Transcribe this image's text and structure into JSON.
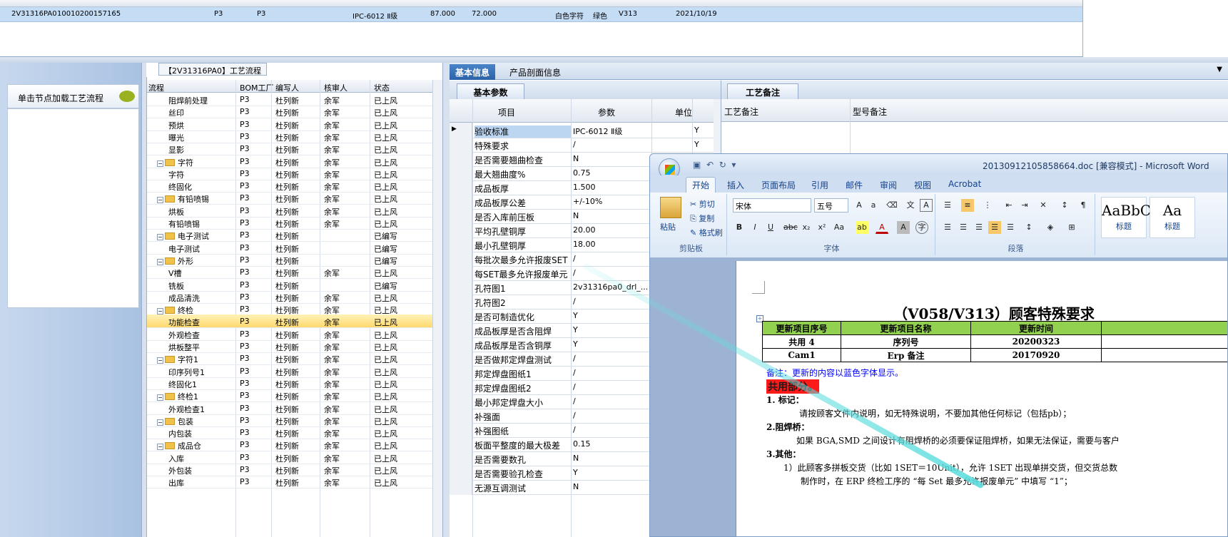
{
  "top_row": {
    "cells": [
      "2V31316PA0",
      "10010200157165",
      "P3",
      "P3",
      "IPC-6012 Ⅱ级",
      "87.000",
      "72.000",
      "白色字符",
      "绿色",
      "V313",
      "2021/10/19"
    ]
  },
  "left_panel": {
    "title": "单击节点加载工艺流程"
  },
  "process": {
    "title": "【2V31316PA0】工艺流程",
    "headers": [
      "流程",
      "BOM工厂",
      "编写人",
      "核审人",
      "状态"
    ],
    "rows": [
      {
        "name": "阻焊前处理",
        "level": 2,
        "bom": "P3",
        "writer": "杜列新",
        "reviewer": "余军",
        "status": "已上风"
      },
      {
        "name": "丝印",
        "level": 2,
        "bom": "P3",
        "writer": "杜列新",
        "reviewer": "余军",
        "status": "已上风"
      },
      {
        "name": "预烘",
        "level": 2,
        "bom": "P3",
        "writer": "杜列新",
        "reviewer": "余军",
        "status": "已上风"
      },
      {
        "name": "曝光",
        "level": 2,
        "bom": "P3",
        "writer": "杜列新",
        "reviewer": "余军",
        "status": "已上风"
      },
      {
        "name": "显影",
        "level": 2,
        "bom": "P3",
        "writer": "杜列新",
        "reviewer": "余军",
        "status": "已上风"
      },
      {
        "name": "字符",
        "level": 1,
        "bom": "P3",
        "writer": "杜列新",
        "reviewer": "余军",
        "status": "已上风"
      },
      {
        "name": "字符",
        "level": 2,
        "bom": "P3",
        "writer": "杜列新",
        "reviewer": "余军",
        "status": "已上风"
      },
      {
        "name": "终固化",
        "level": 2,
        "bom": "P3",
        "writer": "杜列新",
        "reviewer": "余军",
        "status": "已上风"
      },
      {
        "name": "有铅喷锡",
        "level": 1,
        "bom": "P3",
        "writer": "杜列新",
        "reviewer": "余军",
        "status": "已上风"
      },
      {
        "name": "烘板",
        "level": 2,
        "bom": "P3",
        "writer": "杜列新",
        "reviewer": "余军",
        "status": "已上风"
      },
      {
        "name": "有铅喷锡",
        "level": 2,
        "bom": "P3",
        "writer": "杜列新",
        "reviewer": "余军",
        "status": "已上风"
      },
      {
        "name": "电子测试",
        "level": 1,
        "bom": "P3",
        "writer": "杜列新",
        "reviewer": "",
        "status": "已编写"
      },
      {
        "name": "电子测试",
        "level": 2,
        "bom": "P3",
        "writer": "杜列新",
        "reviewer": "",
        "status": "已编写"
      },
      {
        "name": "外形",
        "level": 1,
        "bom": "P3",
        "writer": "杜列新",
        "reviewer": "",
        "status": "已编写"
      },
      {
        "name": "V槽",
        "level": 2,
        "bom": "P3",
        "writer": "杜列新",
        "reviewer": "余军",
        "status": "已上风"
      },
      {
        "name": "铣板",
        "level": 2,
        "bom": "P3",
        "writer": "杜列新",
        "reviewer": "",
        "status": "已编写"
      },
      {
        "name": "成品清洗",
        "level": 2,
        "bom": "P3",
        "writer": "杜列新",
        "reviewer": "余军",
        "status": "已上风"
      },
      {
        "name": "终检",
        "level": 1,
        "bom": "P3",
        "writer": "杜列新",
        "reviewer": "余军",
        "status": "已上风"
      },
      {
        "name": "功能检查",
        "level": 2,
        "bom": "P3",
        "writer": "杜列新",
        "reviewer": "余军",
        "status": "已上风",
        "selected": true
      },
      {
        "name": "外观检查",
        "level": 2,
        "bom": "P3",
        "writer": "杜列新",
        "reviewer": "余军",
        "status": "已上风"
      },
      {
        "name": "烘板整平",
        "level": 2,
        "bom": "P3",
        "writer": "杜列新",
        "reviewer": "余军",
        "status": "已上风"
      },
      {
        "name": "字符1",
        "level": 1,
        "bom": "P3",
        "writer": "杜列新",
        "reviewer": "余军",
        "status": "已上风"
      },
      {
        "name": "印序列号1",
        "level": 2,
        "bom": "P3",
        "writer": "杜列新",
        "reviewer": "余军",
        "status": "已上风"
      },
      {
        "name": "终固化1",
        "level": 2,
        "bom": "P3",
        "writer": "杜列新",
        "reviewer": "余军",
        "status": "已上风"
      },
      {
        "name": "终检1",
        "level": 1,
        "bom": "P3",
        "writer": "杜列新",
        "reviewer": "余军",
        "status": "已上风"
      },
      {
        "name": "外观检查1",
        "level": 2,
        "bom": "P3",
        "writer": "杜列新",
        "reviewer": "余军",
        "status": "已上风"
      },
      {
        "name": "包装",
        "level": 1,
        "bom": "P3",
        "writer": "杜列新",
        "reviewer": "余军",
        "status": "已上风"
      },
      {
        "name": "内包装",
        "level": 2,
        "bom": "P3",
        "writer": "杜列新",
        "reviewer": "余军",
        "status": "已上风"
      },
      {
        "name": "成品仓",
        "level": 1,
        "bom": "P3",
        "writer": "杜列新",
        "reviewer": "余军",
        "status": "已上风"
      },
      {
        "name": "入库",
        "level": 2,
        "bom": "P3",
        "writer": "杜列新",
        "reviewer": "余军",
        "status": "已上风"
      },
      {
        "name": "外包装",
        "level": 2,
        "bom": "P3",
        "writer": "杜列新",
        "reviewer": "余军",
        "status": "已上风"
      },
      {
        "name": "出库",
        "level": 2,
        "bom": "P3",
        "writer": "杜列新",
        "reviewer": "余军",
        "status": "已上风"
      }
    ]
  },
  "info_tabs": {
    "active": "基本信息",
    "other": "产品剖面信息"
  },
  "params": {
    "subtab": "基本参数",
    "headers": [
      "项目",
      "参数",
      "单位"
    ],
    "rows": [
      {
        "k": "验收标准",
        "v": "IPC-6012 Ⅱ级",
        "u": "Y"
      },
      {
        "k": "特殊要求",
        "v": "/",
        "u": "Y"
      },
      {
        "k": "是否需要翘曲检查",
        "v": "N",
        "u": ""
      },
      {
        "k": "最大翘曲度%",
        "v": "0.75",
        "u": ""
      },
      {
        "k": "成品板厚",
        "v": "1.500",
        "u": ""
      },
      {
        "k": "成品板厚公差",
        "v": "+/-10%",
        "u": ""
      },
      {
        "k": "是否入库前压板",
        "v": "N",
        "u": ""
      },
      {
        "k": "平均孔壁铜厚",
        "v": "20.00",
        "u": ""
      },
      {
        "k": "最小孔壁铜厚",
        "v": "18.00",
        "u": ""
      },
      {
        "k": "每批次最多允许报废SET",
        "v": "/",
        "u": ""
      },
      {
        "k": "每SET最多允许报废单元",
        "v": "/",
        "u": ""
      },
      {
        "k": "孔符图1",
        "v": "2v31316pa0_drl_...",
        "u": ""
      },
      {
        "k": "孔符图2",
        "v": "/",
        "u": ""
      },
      {
        "k": "是否可制造优化",
        "v": "Y",
        "u": ""
      },
      {
        "k": "成品板厚是否含阻焊",
        "v": "Y",
        "u": ""
      },
      {
        "k": "成品板厚是否含铜厚",
        "v": "Y",
        "u": ""
      },
      {
        "k": "是否做邦定焊盘测试",
        "v": "/",
        "u": ""
      },
      {
        "k": "邦定焊盘图纸1",
        "v": "/",
        "u": ""
      },
      {
        "k": "邦定焊盘图纸2",
        "v": "/",
        "u": ""
      },
      {
        "k": "最小邦定焊盘大小",
        "v": "/",
        "u": ""
      },
      {
        "k": "补强面",
        "v": "/",
        "u": ""
      },
      {
        "k": "补强图纸",
        "v": "/",
        "u": ""
      },
      {
        "k": "板面平整度的最大极差",
        "v": "0.15",
        "u": ""
      },
      {
        "k": "是否需要数孔",
        "v": "N",
        "u": ""
      },
      {
        "k": "是否需要验孔检查",
        "v": "Y",
        "u": ""
      },
      {
        "k": "无源互调测试",
        "v": "N",
        "u": ""
      }
    ]
  },
  "notes": {
    "tab": "工艺备注",
    "col1": "工艺备注",
    "col2": "型号备注"
  },
  "word": {
    "title": "20130912105858664.doc [兼容模式] - Microsoft Word",
    "tabs": [
      "开始",
      "插入",
      "页面布局",
      "引用",
      "邮件",
      "审阅",
      "视图",
      "Acrobat"
    ],
    "clipboard": {
      "paste": "粘贴",
      "cut": "剪切",
      "copy": "复制",
      "format": "格式刷",
      "label": "剪贴板"
    },
    "font": {
      "name": "宋体",
      "size": "五号",
      "label": "字体"
    },
    "paragraph": {
      "label": "段落"
    },
    "styles": [
      {
        "sample": "AaBbC",
        "name": "标题"
      },
      {
        "sample": "Aa",
        "name": "标题"
      }
    ],
    "doc": {
      "heading": "（V058/V313）顾客特殊要求",
      "table_headers": [
        "更新项目序号",
        "更新项目名称",
        "更新时间"
      ],
      "table_rows": [
        [
          "共用 4",
          "序列号",
          "20200323"
        ],
        [
          "Cam1",
          "Erp 备注",
          "20170920"
        ]
      ],
      "note": "备注：更新的内容以蓝色字体显示。",
      "common": "共用部分。",
      "l1": "1.   标记：",
      "l1t": "请按顾客文件内说明，如无特殊说明，不要加其他任何标记（包括pb）；",
      "l2": "2.阻焊桥：",
      "l2t": "如果 BGA,SMD 之间设计有阻焊桥的必须要保证阻焊桥，如果无法保证，需要与客户",
      "l3": "3.其他：",
      "l3a": "1）此顾客多拼板交货（比如 1SET＝10Unit），允许 1SET 出现单拼交货，但交货总数",
      "l3b": "制作时，在 ERP 终检工序的 “每 Set 最多允许报废单元” 中填写 “1”；"
    }
  }
}
